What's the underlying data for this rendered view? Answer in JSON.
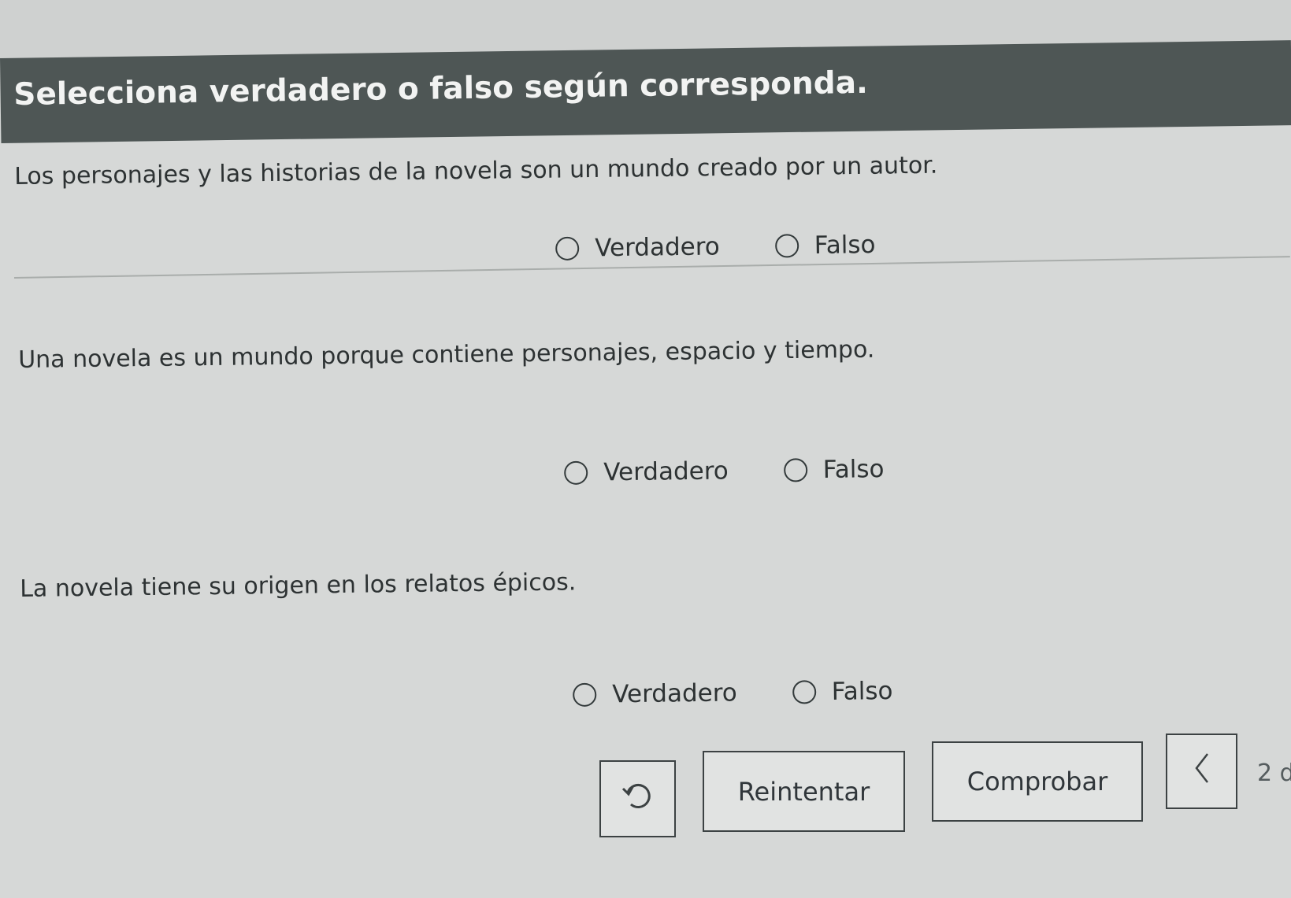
{
  "header": {
    "title": "Selecciona verdadero o falso según corresponda."
  },
  "questions": [
    {
      "text": "Los personajes y las historias de la novela son un mundo creado por un autor.",
      "options": [
        "Verdadero",
        "Falso"
      ]
    },
    {
      "text": "Una novela es un mundo porque contiene personajes, espacio y tiempo.",
      "options": [
        "Verdadero",
        "Falso"
      ]
    },
    {
      "text": "La novela tiene su origen en los relatos épicos.",
      "options": [
        "Verdadero",
        "Falso"
      ]
    }
  ],
  "footer": {
    "retry_label": "Reintentar",
    "check_label": "Comprobar",
    "page_indicator": "2 d"
  },
  "icons": {
    "reset": "undo-icon",
    "prev": "chevron-left-icon"
  },
  "colors": {
    "header_bg": "#4e5655",
    "header_text": "#f2f3f2",
    "page_bg": "#d6d8d7"
  }
}
